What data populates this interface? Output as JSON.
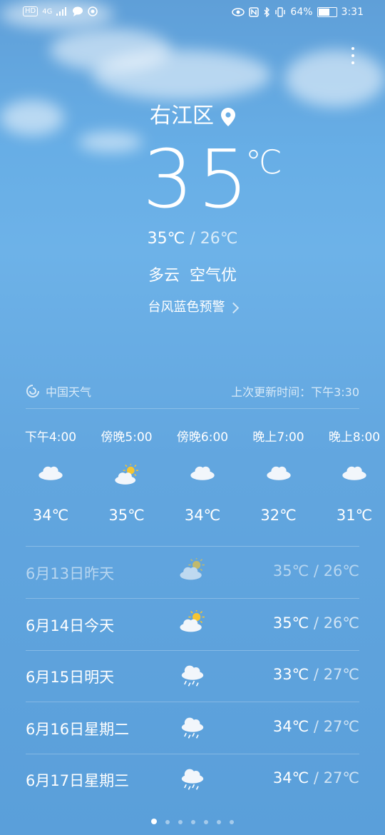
{
  "status_bar": {
    "left_badge": "HD",
    "network": "4G",
    "battery_percent": "64%",
    "battery_level": 0.64,
    "time": "3:31"
  },
  "location": {
    "city": "右江区"
  },
  "current": {
    "temp": "35",
    "unit": "℃",
    "high": "35℃",
    "separator": "/",
    "low": "26℃",
    "condition": "多云",
    "air_quality": "空气优",
    "warning": "台风蓝色预警"
  },
  "source": {
    "provider": "中国天气",
    "updated": "上次更新时间：下午3:30"
  },
  "hourly": [
    {
      "time": "下午4:00",
      "icon": "cloud-icon",
      "temp": "34℃"
    },
    {
      "time": "傍晚5:00",
      "icon": "partly-sunny-icon",
      "temp": "35℃"
    },
    {
      "time": "傍晚6:00",
      "icon": "cloud-icon",
      "temp": "34℃"
    },
    {
      "time": "晚上7:00",
      "icon": "cloud-icon",
      "temp": "32℃"
    },
    {
      "time": "晚上8:00",
      "icon": "cloud-icon",
      "temp": "31℃"
    }
  ],
  "daily": [
    {
      "date": "6月13日昨天",
      "icon": "partly-sunny-icon",
      "high": "35℃",
      "sep": "/",
      "low": "26℃",
      "past": true
    },
    {
      "date": "6月14日今天",
      "icon": "partly-sunny-icon",
      "high": "35℃",
      "sep": "/",
      "low": "26℃",
      "past": false
    },
    {
      "date": "6月15日明天",
      "icon": "rain-icon",
      "high": "33℃",
      "sep": "/",
      "low": "27℃",
      "past": false
    },
    {
      "date": "6月16日星期二",
      "icon": "rain-icon",
      "high": "34℃",
      "sep": "/",
      "low": "27℃",
      "past": false
    },
    {
      "date": "6月17日星期三",
      "icon": "rain-icon",
      "high": "34℃",
      "sep": "/",
      "low": "27℃",
      "past": false
    }
  ],
  "pager": {
    "count": 7,
    "active": 0
  },
  "colors": {
    "sun": "#f6c531",
    "cloud": "#f2f6fb",
    "rain": "#ffffff"
  }
}
